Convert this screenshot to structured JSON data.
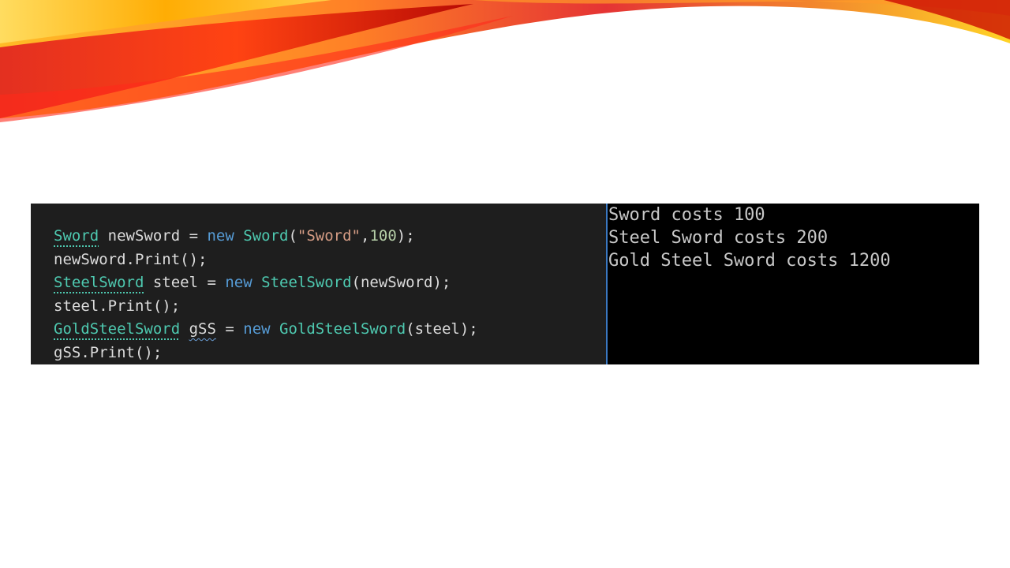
{
  "code": {
    "line1": {
      "type1": "Sword",
      "var": " newSword = ",
      "kw": "new",
      "sp": " ",
      "type2": "Sword",
      "open": "(",
      "str": "\"Sword\"",
      "comma": ",",
      "num": "100",
      "close": ");"
    },
    "line2": {
      "text": "newSword.Print();"
    },
    "line3": {
      "type1": "SteelSword",
      "var": " steel = ",
      "kw": "new",
      "sp": " ",
      "type2": "SteelSword",
      "args": "(newSword);"
    },
    "line4": {
      "text": "steel.Print();"
    },
    "line5": {
      "type1": "GoldSteelSword",
      "sp1": " ",
      "var": "gSS",
      "eq": " = ",
      "kw": "new",
      "sp": " ",
      "type2": "GoldSteelSword",
      "args": "(steel);"
    },
    "line6": {
      "text": "gSS.Print();"
    }
  },
  "console": {
    "lines": [
      "Sword costs 100",
      "Steel Sword costs 200",
      "Gold Steel Sword costs 1200"
    ]
  },
  "colors": {
    "type": "#4ec9b0",
    "keyword": "#569cd6",
    "string": "#d69d85",
    "number": "#b5cea8",
    "plain": "#dcdcdc",
    "editor_bg": "#1e1e1e",
    "console_bg": "#000000",
    "divider": "#3a78c2"
  }
}
